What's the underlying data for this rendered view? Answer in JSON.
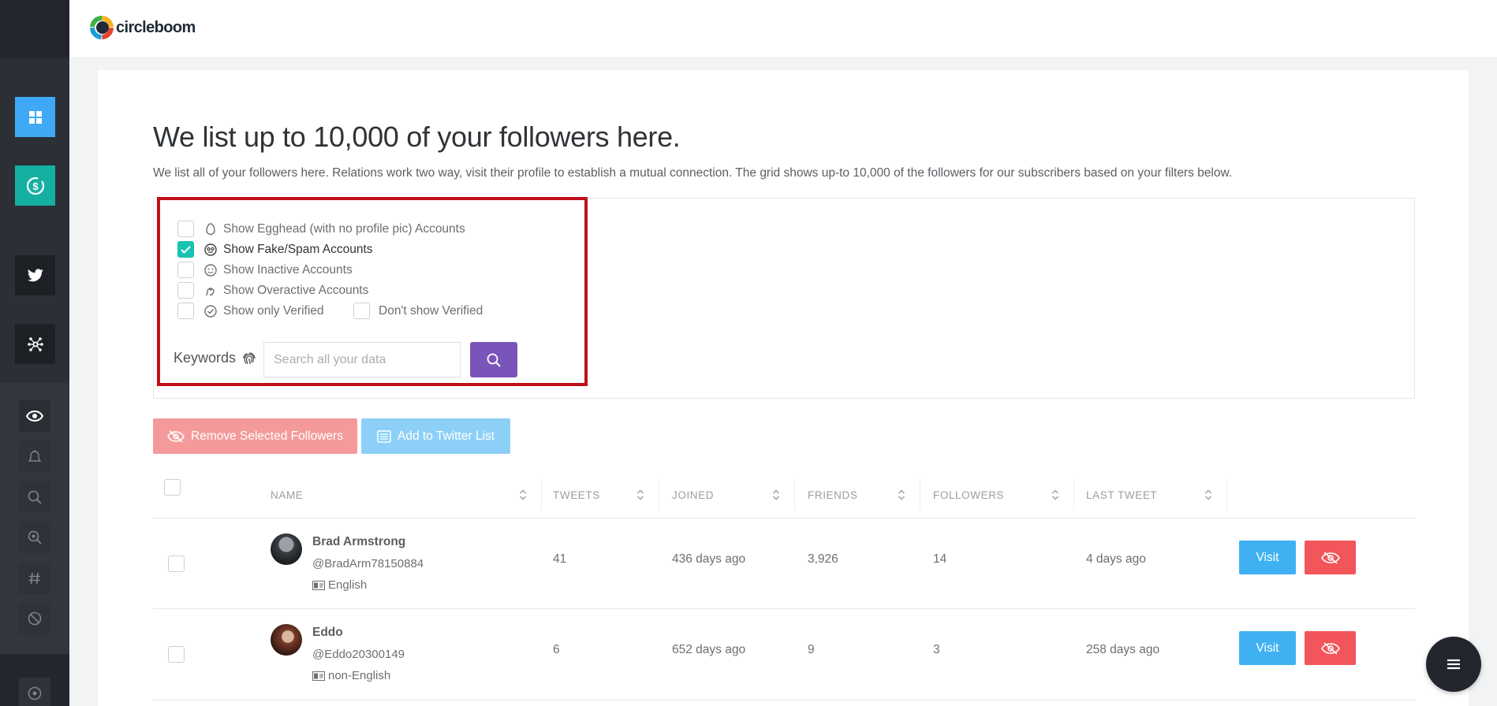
{
  "app": {
    "logo_text": "circleboom"
  },
  "sidebar": {
    "items": [
      {
        "icon": "dashboard-icon"
      },
      {
        "icon": "dollar-icon"
      },
      {
        "icon": "twitter-icon"
      },
      {
        "icon": "network-icon"
      },
      {
        "icon": "eye-icon"
      },
      {
        "icon": "bell-icon"
      },
      {
        "icon": "search-icon"
      },
      {
        "icon": "search-location-icon"
      },
      {
        "icon": "hashtag-icon"
      },
      {
        "icon": "block-icon"
      },
      {
        "icon": "circle-icon"
      }
    ]
  },
  "page": {
    "title": "We list up to 10,000 of your followers here.",
    "subtitle": "We list all of your followers here. Relations work two way, visit their profile to establish a mutual connection. The grid shows up-to 10,000 of the followers for our subscribers based on your filters below."
  },
  "filters": {
    "options": [
      {
        "label": "Show Egghead (with no profile pic) Accounts",
        "checked": false,
        "icon": "egg-icon"
      },
      {
        "label": "Show Fake/Spam Accounts",
        "checked": true,
        "icon": "robot-icon"
      },
      {
        "label": "Show Inactive Accounts",
        "checked": false,
        "icon": "smile-icon"
      },
      {
        "label": "Show Overactive Accounts",
        "checked": false,
        "icon": "overactive-icon"
      },
      {
        "label": "Show only Verified",
        "checked": false,
        "icon": "verified-icon"
      }
    ],
    "dont_show_verified": {
      "label": "Don't show Verified",
      "checked": false
    },
    "keywords_label": "Keywords",
    "search_placeholder": "Search all your data"
  },
  "actions": {
    "remove_label": "Remove Selected Followers",
    "add_list_label": "Add to Twitter List"
  },
  "table": {
    "headers": [
      "NAME",
      "TWEETS",
      "JOINED",
      "FRIENDS",
      "FOLLOWERS",
      "LAST TWEET"
    ],
    "rows": [
      {
        "name": "Brad Armstrong",
        "handle": "@BradArm78150884",
        "language": "English",
        "tweets": "41",
        "joined": "436 days ago",
        "friends": "3,926",
        "followers": "14",
        "last_tweet": "4 days ago",
        "visit_label": "Visit"
      },
      {
        "name": "Eddo",
        "handle": "@Eddo20300149",
        "language": "non-English",
        "tweets": "6",
        "joined": "652 days ago",
        "friends": "9",
        "followers": "3",
        "last_tweet": "258 days ago",
        "visit_label": "Visit"
      }
    ]
  },
  "colors": {
    "teal": "#17c3b2",
    "purple": "#7a55b9",
    "visit_blue": "#3fb1f2",
    "hide_red": "#f2555a",
    "highlight_red": "#c0101a"
  }
}
